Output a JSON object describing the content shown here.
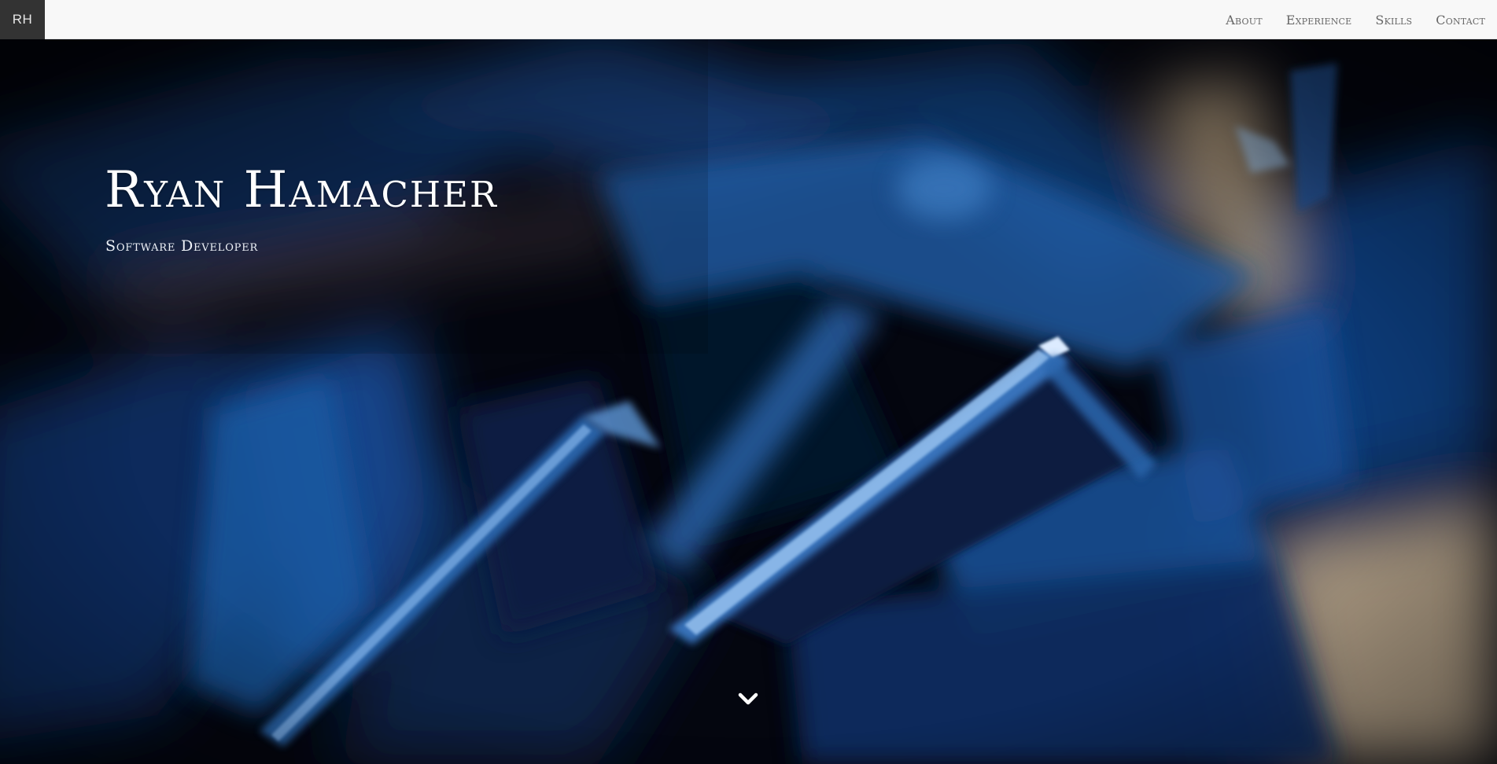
{
  "nav": {
    "brand": "RH",
    "links": [
      {
        "label": "About"
      },
      {
        "label": "Experience"
      },
      {
        "label": "Skills"
      },
      {
        "label": "Contact"
      }
    ]
  },
  "hero": {
    "title": "Ryan Hamacher",
    "subtitle": "Software Developer",
    "scroll_icon": "chevron-down-icon"
  },
  "colors": {
    "navbar_bg": "#f8f8f8",
    "brand_bg": "#333333",
    "nav_text": "#666666",
    "hero_text": "#ffffff",
    "hero_dark": "#04060f",
    "hero_blue": "#1a5fa6",
    "hero_tan": "#c9b28d"
  }
}
